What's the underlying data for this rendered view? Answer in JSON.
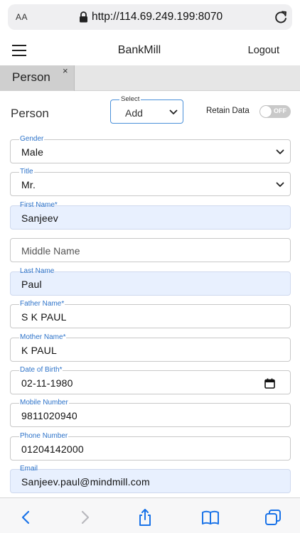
{
  "browser": {
    "text_size_label": "AA",
    "url": "http://114.69.249.199:8070"
  },
  "header": {
    "brand": "BankMill",
    "logout_label": "Logout"
  },
  "tabs": [
    {
      "label": "Person",
      "close_label": "×"
    }
  ],
  "form": {
    "title": "Person",
    "mode_select": {
      "legend": "Select",
      "value": "Add"
    },
    "retain": {
      "label": "Retain Data",
      "toggle_text": "OFF",
      "on": false
    }
  },
  "fields": {
    "gender": {
      "label": "Gender",
      "value": "Male"
    },
    "title": {
      "label": "Title",
      "value": "Mr."
    },
    "first_name": {
      "label": "First Name*",
      "value": "Sanjeev"
    },
    "middle_name": {
      "placeholder": "Middle Name"
    },
    "last_name": {
      "label": "Last Name",
      "value": "Paul"
    },
    "father_name": {
      "label": "Father Name*",
      "value": "S K PAUL"
    },
    "mother_name": {
      "label": "Mother Name*",
      "value": "K PAUL"
    },
    "dob": {
      "label": "Date of Birth*",
      "value": "02-11-1980"
    },
    "mobile": {
      "label": "Mobile Number",
      "value": "9811020940"
    },
    "phone": {
      "label": "Phone Number",
      "value": "01204142000"
    },
    "email": {
      "label": "Email",
      "value": "Sanjeev.paul@mindmill.com"
    }
  },
  "toolbar_icons": [
    "back-icon",
    "forward-icon",
    "share-icon",
    "bookmarks-icon",
    "tabs-icon"
  ],
  "colors": {
    "accent": "#2d73c9",
    "autofill_bg": "#e8f0fe",
    "tab_bg": "#cfcfcf"
  }
}
